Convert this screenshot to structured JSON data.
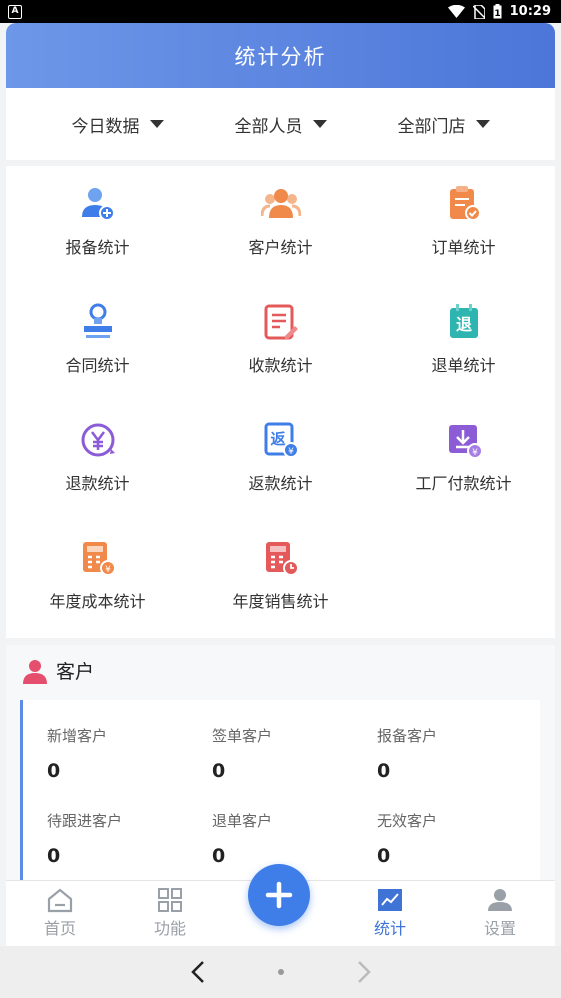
{
  "status_bar": {
    "badge": "A",
    "time": "10:29",
    "battery": "1"
  },
  "header": {
    "title": "统计分析"
  },
  "filters": [
    {
      "label": "今日数据"
    },
    {
      "label": "全部人员"
    },
    {
      "label": "全部门店"
    }
  ],
  "grid": [
    {
      "label": "报备统计",
      "icon": "report-user-icon"
    },
    {
      "label": "客户统计",
      "icon": "customers-icon"
    },
    {
      "label": "订单统计",
      "icon": "order-clipboard-icon"
    },
    {
      "label": "合同统计",
      "icon": "contract-stamp-icon"
    },
    {
      "label": "收款统计",
      "icon": "receipt-icon"
    },
    {
      "label": "退单统计",
      "icon": "refund-order-icon"
    },
    {
      "label": "退款统计",
      "icon": "yen-refund-icon"
    },
    {
      "label": "返款统计",
      "icon": "rebate-icon"
    },
    {
      "label": "工厂付款统计",
      "icon": "factory-payment-icon"
    },
    {
      "label": "年度成本统计",
      "icon": "annual-cost-icon"
    },
    {
      "label": "年度销售统计",
      "icon": "annual-sales-icon"
    }
  ],
  "customer_section": {
    "title": "客户",
    "stats": [
      {
        "label": "新增客户",
        "value": "0"
      },
      {
        "label": "签单客户",
        "value": "0"
      },
      {
        "label": "报备客户",
        "value": "0"
      },
      {
        "label": "待跟进客户",
        "value": "0"
      },
      {
        "label": "退单客户",
        "value": "0"
      },
      {
        "label": "无效客户",
        "value": "0"
      }
    ]
  },
  "tabbar": {
    "tabs": [
      {
        "label": "首页",
        "icon": "home-icon"
      },
      {
        "label": "功能",
        "icon": "grid-icon"
      },
      {
        "label": "统计",
        "icon": "chart-icon",
        "active": true
      },
      {
        "label": "设置",
        "icon": "user-settings-icon"
      }
    ],
    "fab": {
      "icon": "plus-icon"
    }
  },
  "colors": {
    "primary": "#3f74d6",
    "header_start": "#6d97e8",
    "header_end": "#4c76d8"
  }
}
